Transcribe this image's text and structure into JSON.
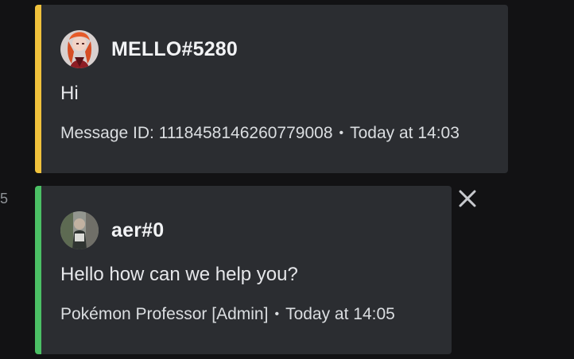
{
  "left_edge_number": "5",
  "messages": [
    {
      "author": "MELLO#5280",
      "text": "Hi",
      "footer_left": "Message ID: 1118458146260779008",
      "separator": "•",
      "footer_time": "Today at 14:03",
      "accent_color": "#f0c23c",
      "avatar_icon": "anime-character-avatar"
    },
    {
      "author": "aer#0",
      "text": "Hello how can we help you?",
      "footer_left": "Pokémon Professor [Admin]",
      "separator": "•",
      "footer_time": "Today at 14:05",
      "accent_color": "#4bc065",
      "avatar_icon": "photo-avatar"
    }
  ],
  "close_icon": "close-icon"
}
